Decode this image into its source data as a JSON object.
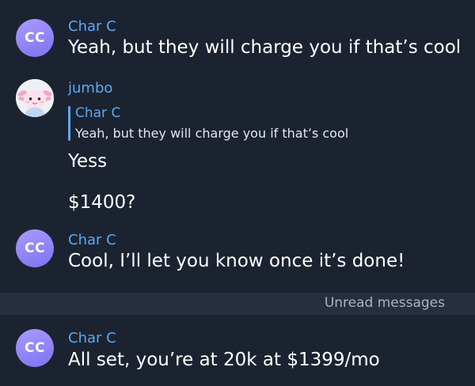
{
  "messages": [
    {
      "sender": "Char C",
      "avatar_initials": "CC",
      "lines": [
        "Yeah, but they will charge you if that’s cool"
      ]
    },
    {
      "sender": "jumbo",
      "avatar_icon": "axolotl-avatar-icon",
      "reply": {
        "sender": "Char C",
        "text": "Yeah, but they will charge you if that’s cool"
      },
      "lines": [
        "Yess",
        "$1400?"
      ]
    },
    {
      "sender": "Char C",
      "avatar_initials": "CC",
      "lines": [
        "Cool, I’ll let you know once it’s done!"
      ]
    },
    {
      "sender": "Char C",
      "avatar_initials": "CC",
      "lines": [
        "All set, you’re at 20k at $1399/mo"
      ]
    }
  ],
  "unread_divider": {
    "label": "Unread messages"
  },
  "colors": {
    "background": "#1c2330",
    "sender_name": "#5aa9f5",
    "avatar_gradient_top": "#a99bff",
    "avatar_gradient_bottom": "#7f72ee",
    "unread_bar": "#262f3e",
    "unread_text": "#a9b2c0"
  }
}
